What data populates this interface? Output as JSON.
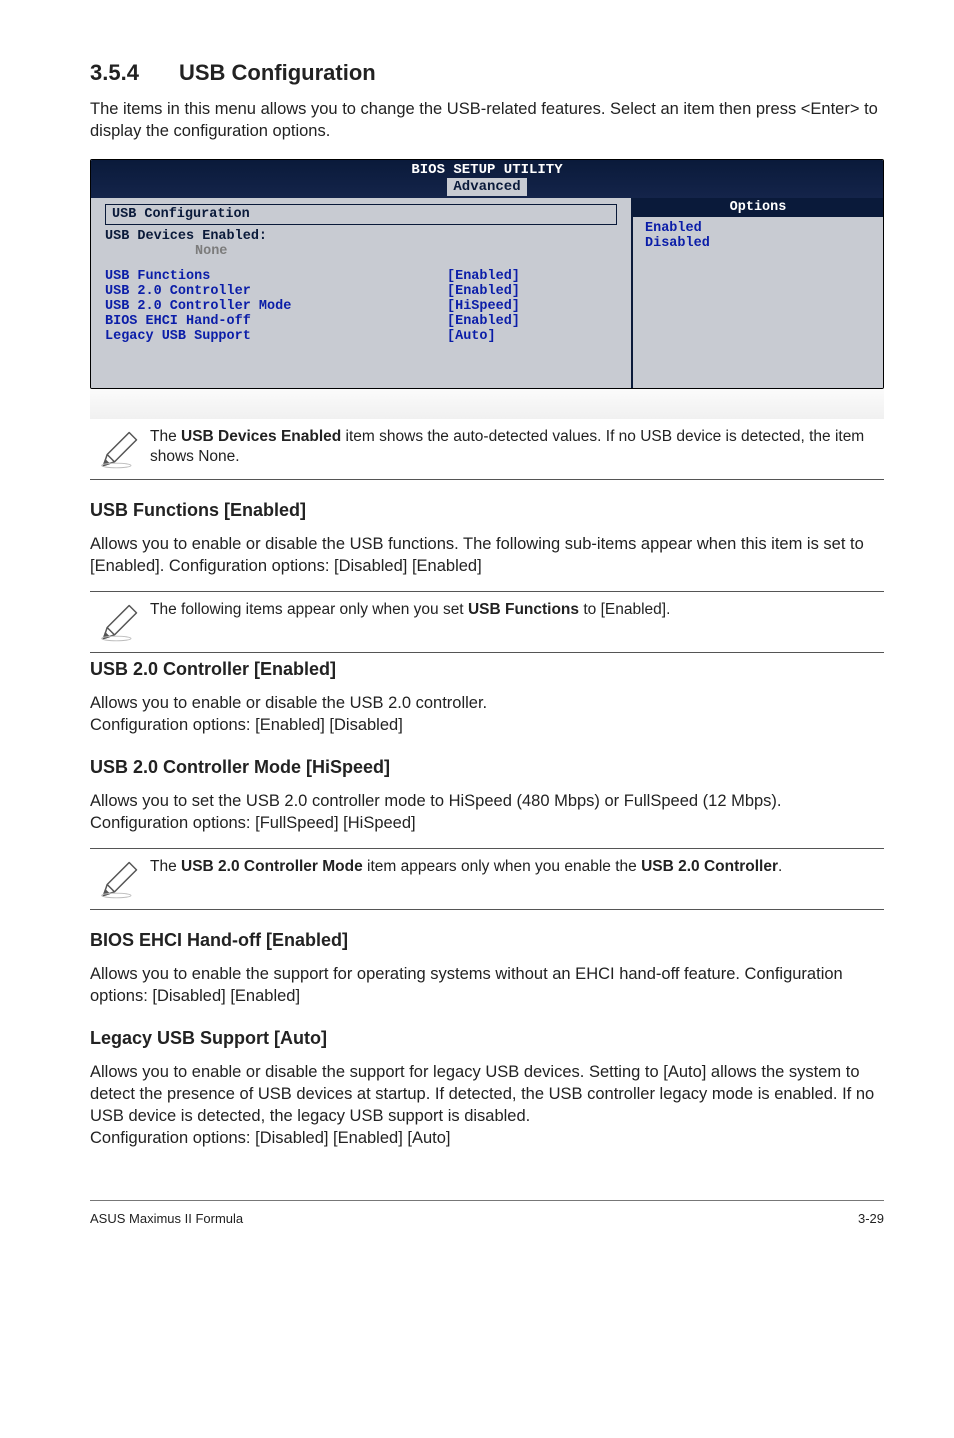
{
  "section": {
    "number": "3.5.4",
    "title": "USB Configuration"
  },
  "intro": "The items in this menu allows you to change the USB-related features. Select an item then press <Enter> to display the configuration options.",
  "bios": {
    "title": "BIOS SETUP UTILITY",
    "tab": "Advanced",
    "left_header": "USB Configuration",
    "devices_label": "USB Devices Enabled:",
    "devices_value": "None",
    "rows": [
      {
        "label": "USB Functions",
        "value": "[Enabled]"
      },
      {
        "label": "USB 2.0 Controller",
        "value": "[Enabled]"
      },
      {
        "label": "USB 2.0 Controller Mode",
        "value": "[HiSpeed]"
      },
      {
        "label": "BIOS EHCI Hand-off",
        "value": "[Enabled]"
      },
      {
        "label": "Legacy USB Support",
        "value": "[Auto]"
      }
    ],
    "options_header": "Options",
    "options": [
      "Enabled",
      "Disabled"
    ]
  },
  "note1_pre": "The ",
  "note1_bold": "USB Devices Enabled",
  "note1_post": " item shows the auto-detected values. If no USB device is detected, the item shows None.",
  "usb_functions": {
    "heading": "USB Functions [Enabled]",
    "body": "Allows you to enable or disable the USB functions. The following sub-items appear when this item is set to [Enabled]. Configuration options: [Disabled] [Enabled]"
  },
  "note2_pre": "The following items appear only when you set ",
  "note2_bold": "USB Functions",
  "note2_post": " to [Enabled].",
  "usb20_controller": {
    "heading": "USB 2.0 Controller [Enabled]",
    "body": "Allows you to enable or disable the USB 2.0 controller.\nConfiguration options: [Enabled] [Disabled]"
  },
  "usb20_mode": {
    "heading": "USB 2.0 Controller Mode [HiSpeed]",
    "body": "Allows you to set the USB 2.0 controller mode to HiSpeed (480 Mbps) or FullSpeed (12 Mbps). Configuration options: [FullSpeed] [HiSpeed]"
  },
  "note3_pre": "The ",
  "note3_bold1": "USB 2.0 Controller Mode",
  "note3_mid": " item appears only when you enable the ",
  "note3_bold2": "USB 2.0 Controller",
  "note3_post": ".",
  "ehci": {
    "heading": "BIOS EHCI Hand-off [Enabled]",
    "body": "Allows you to enable the support for operating systems without an EHCI hand-off feature. Configuration options: [Disabled] [Enabled]"
  },
  "legacy": {
    "heading": "Legacy USB Support [Auto]",
    "body": "Allows you to enable or disable the support for legacy USB devices. Setting to [Auto] allows the system to detect the presence of USB devices at startup. If detected, the USB controller legacy mode is enabled. If no USB device is detected, the legacy USB support is disabled.\nConfiguration options: [Disabled] [Enabled] [Auto]"
  },
  "footer": {
    "left": "ASUS Maximus II Formula",
    "right": "3-29"
  }
}
